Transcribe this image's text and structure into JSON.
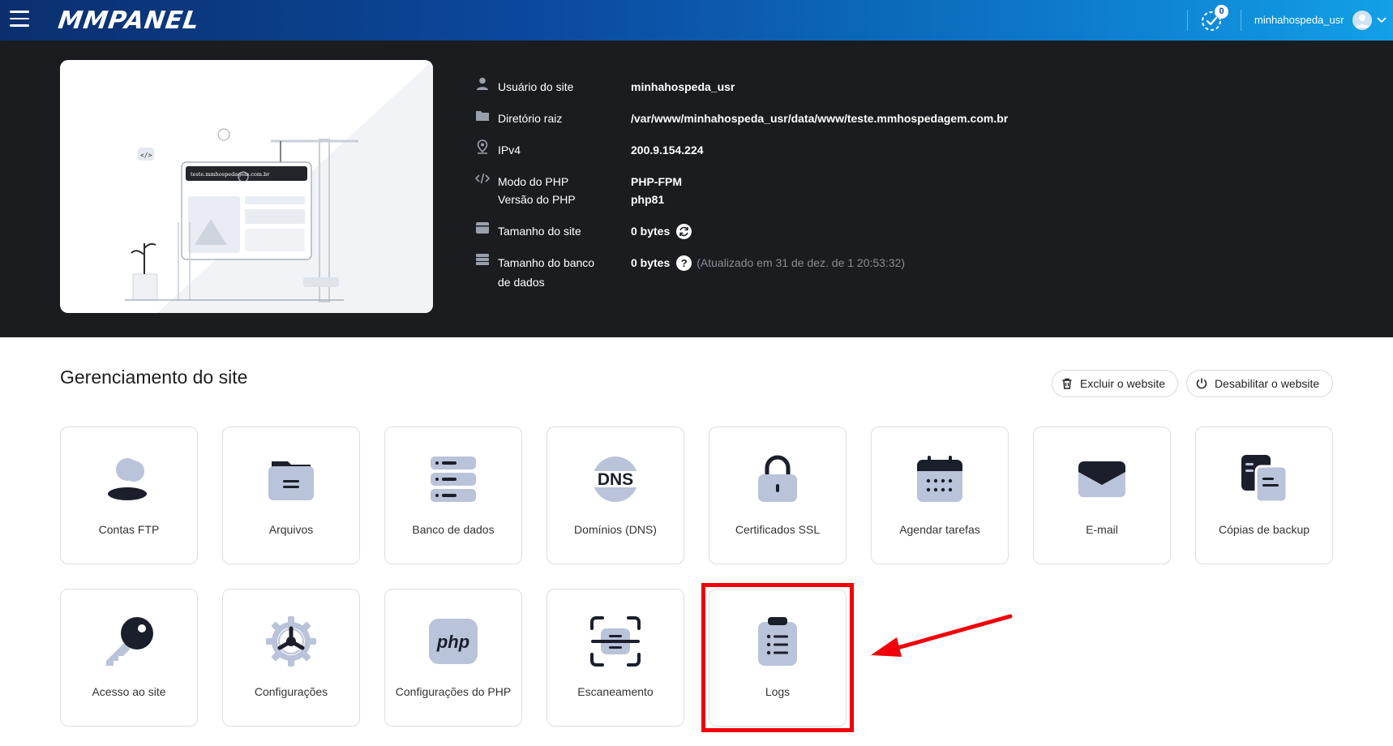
{
  "topbar": {
    "logo": "MMPANEL",
    "tasks_count": "0",
    "username": "minhahospeda_usr"
  },
  "hero": {
    "preview_domain": "teste.mmhospedagem.com.br",
    "rows": [
      {
        "icon": "user-icon",
        "label": "Usuário do site",
        "value": "minhahospeda_usr"
      },
      {
        "icon": "folder-icon",
        "label": "Diretório raiz",
        "value": "/var/www/minhahospeda_usr/data/www/teste.mmhospedagem.com.br"
      },
      {
        "icon": "location-pin-icon",
        "label": "IPv4",
        "value": "200.9.154.224"
      },
      {
        "icon": "code-icon",
        "label": "Modo do PHP",
        "value": "PHP-FPM"
      },
      {
        "icon": "",
        "label": "Versão do PHP",
        "value": "php81"
      },
      {
        "icon": "disk-icon",
        "label": "Tamanho do site",
        "value": "0 bytes"
      },
      {
        "icon": "database-icon",
        "label": "Tamanho do banco",
        "label2": "de dados",
        "value": "0 bytes",
        "note": "(Atualizado em 31 de dez. de 1 20:53:32)"
      }
    ]
  },
  "management": {
    "title": "Gerenciamento do site",
    "delete_label": "Excluir o website",
    "disable_label": "Desabilitar o website",
    "tiles": [
      {
        "icon": "ftp-accounts-icon",
        "label": "Contas FTP"
      },
      {
        "icon": "files-icon",
        "label": "Arquivos"
      },
      {
        "icon": "database-icon",
        "label": "Banco de dados"
      },
      {
        "icon": "dns-icon",
        "label": "Domínios (DNS)"
      },
      {
        "icon": "lock-icon",
        "label": "Certificados SSL"
      },
      {
        "icon": "calendar-icon",
        "label": "Agendar tarefas"
      },
      {
        "icon": "email-icon",
        "label": "E-mail"
      },
      {
        "icon": "backup-copies-icon",
        "label": "Cópias de backup"
      },
      {
        "icon": "key-icon",
        "label": "Acesso ao site"
      },
      {
        "icon": "gear-icon",
        "label": "Configurações"
      },
      {
        "icon": "php-icon",
        "label": "Configurações do PHP"
      },
      {
        "icon": "scan-icon",
        "label": "Escaneamento"
      },
      {
        "icon": "clipboard-list-icon",
        "label": "Logs"
      }
    ]
  },
  "colors": {
    "tile_icon": "#b9c3d9",
    "tile_icon_dark": "#1b1f2b",
    "highlight": "#f0000a"
  }
}
